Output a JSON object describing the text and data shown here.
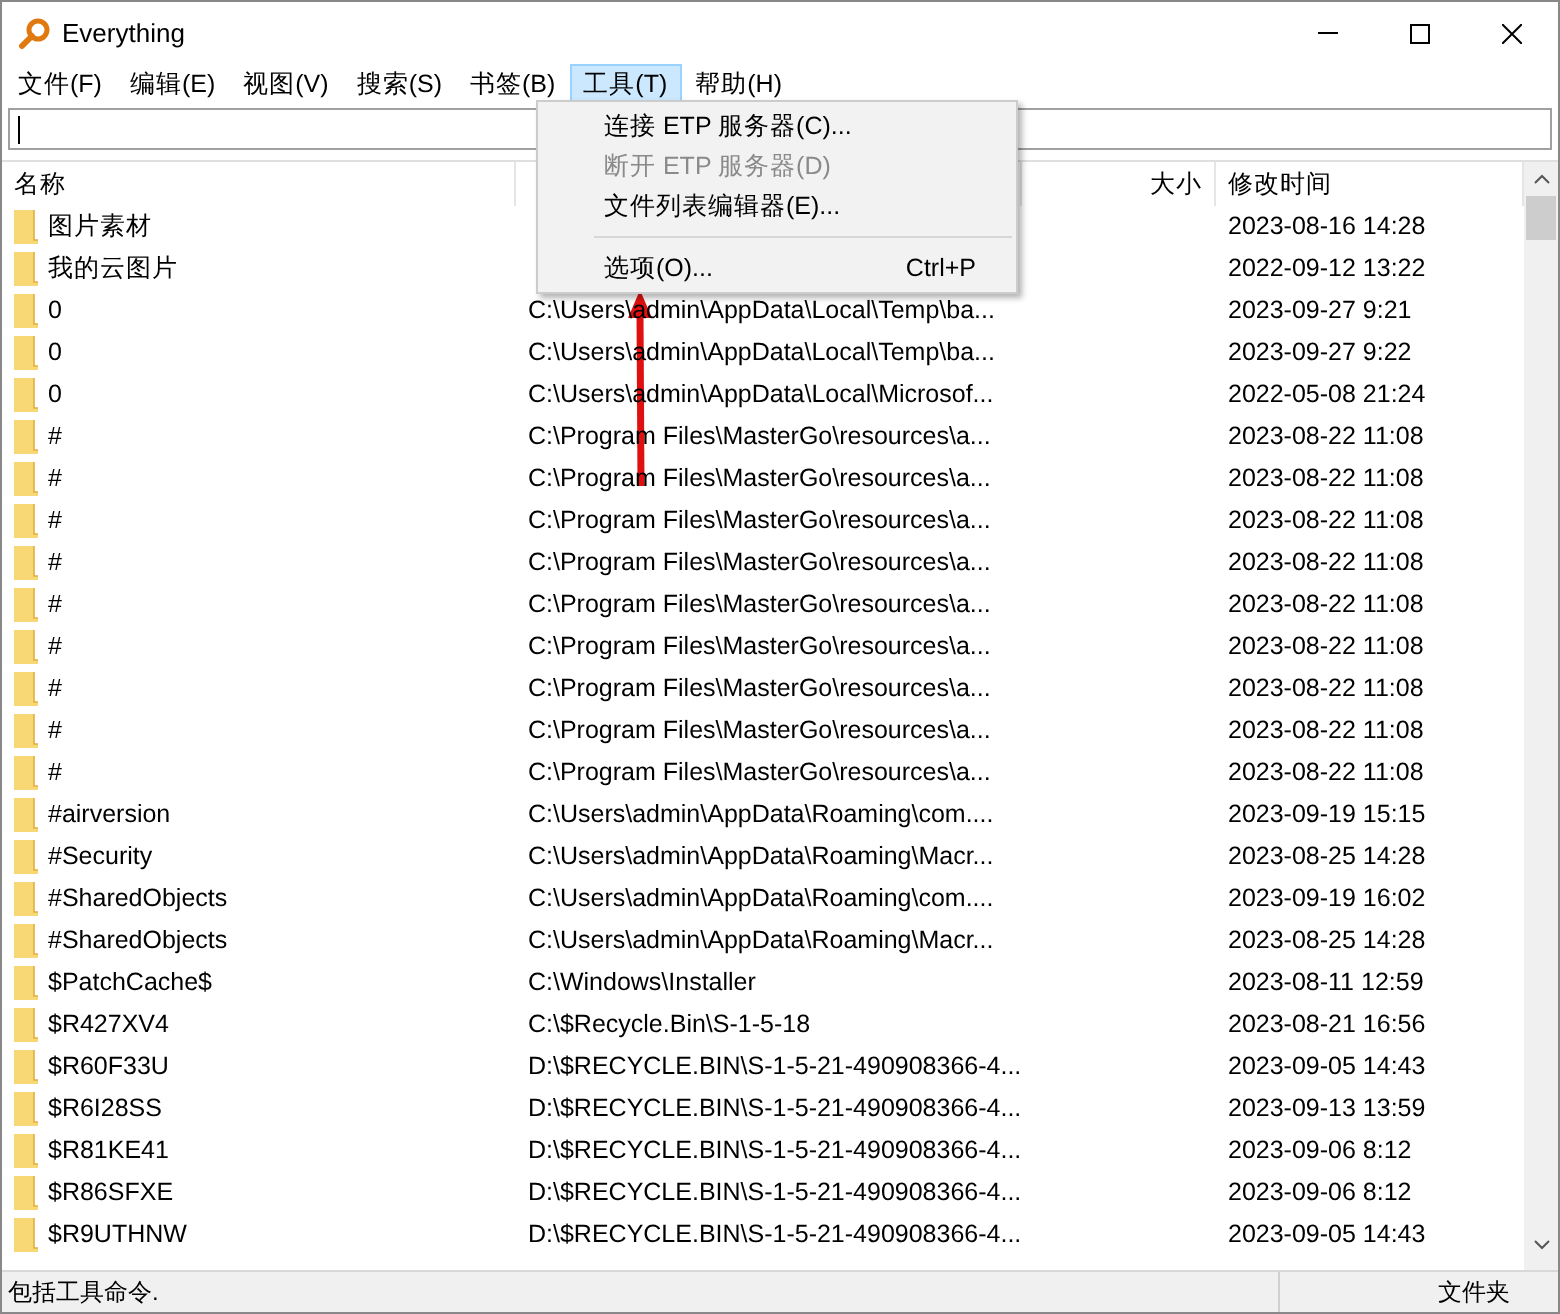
{
  "window": {
    "title": "Everything"
  },
  "menubar": [
    {
      "label": "文件(F)",
      "selected": false
    },
    {
      "label": "编辑(E)",
      "selected": false
    },
    {
      "label": "视图(V)",
      "selected": false
    },
    {
      "label": "搜索(S)",
      "selected": false
    },
    {
      "label": "书签(B)",
      "selected": false
    },
    {
      "label": "工具(T)",
      "selected": true
    },
    {
      "label": "帮助(H)",
      "selected": false
    }
  ],
  "menu": [
    {
      "kind": "item",
      "label": "连接 ETP 服务器(C)...",
      "disabled": false
    },
    {
      "kind": "item",
      "label": "断开 ETP 服务器(D)",
      "disabled": true
    },
    {
      "kind": "item",
      "label": "文件列表编辑器(E)...",
      "disabled": false
    },
    {
      "kind": "separator"
    },
    {
      "kind": "item",
      "label": "选项(O)...",
      "shortcut": "Ctrl+P",
      "disabled": false
    }
  ],
  "table": {
    "columns": [
      {
        "label": "名称"
      },
      {},
      {
        "label": "大小"
      },
      {
        "label": "修改时间"
      }
    ],
    "rows": [
      {
        "name": "图片素材",
        "modified": "2023-08-16 14:28"
      },
      {
        "name": "我的云图片",
        "modified": "2022-09-12 13:22"
      },
      {
        "name": "0",
        "path": "C:\\Users\\admin\\AppData\\Local\\Temp\\ba...",
        "modified": "2023-09-27 9:21"
      },
      {
        "name": "0",
        "path": "C:\\Users\\admin\\AppData\\Local\\Temp\\ba...",
        "modified": "2023-09-27 9:22"
      },
      {
        "name": "0",
        "path": "C:\\Users\\admin\\AppData\\Local\\Microsof...",
        "modified": "2022-05-08 21:24"
      },
      {
        "name": "#",
        "path": "C:\\Program Files\\MasterGo\\resources\\a...",
        "modified": "2023-08-22 11:08"
      },
      {
        "name": "#",
        "path": "C:\\Program Files\\MasterGo\\resources\\a...",
        "modified": "2023-08-22 11:08"
      },
      {
        "name": "#",
        "path": "C:\\Program Files\\MasterGo\\resources\\a...",
        "modified": "2023-08-22 11:08"
      },
      {
        "name": "#",
        "path": "C:\\Program Files\\MasterGo\\resources\\a...",
        "modified": "2023-08-22 11:08"
      },
      {
        "name": "#",
        "path": "C:\\Program Files\\MasterGo\\resources\\a...",
        "modified": "2023-08-22 11:08"
      },
      {
        "name": "#",
        "path": "C:\\Program Files\\MasterGo\\resources\\a...",
        "modified": "2023-08-22 11:08"
      },
      {
        "name": "#",
        "path": "C:\\Program Files\\MasterGo\\resources\\a...",
        "modified": "2023-08-22 11:08"
      },
      {
        "name": "#",
        "path": "C:\\Program Files\\MasterGo\\resources\\a...",
        "modified": "2023-08-22 11:08"
      },
      {
        "name": "#",
        "path": "C:\\Program Files\\MasterGo\\resources\\a...",
        "modified": "2023-08-22 11:08"
      },
      {
        "name": "#airversion",
        "path": "C:\\Users\\admin\\AppData\\Roaming\\com....",
        "modified": "2023-09-19 15:15"
      },
      {
        "name": "#Security",
        "path": "C:\\Users\\admin\\AppData\\Roaming\\Macr...",
        "modified": "2023-08-25 14:28"
      },
      {
        "name": "#SharedObjects",
        "path": "C:\\Users\\admin\\AppData\\Roaming\\com....",
        "modified": "2023-09-19 16:02"
      },
      {
        "name": "#SharedObjects",
        "path": "C:\\Users\\admin\\AppData\\Roaming\\Macr...",
        "modified": "2023-08-25 14:28"
      },
      {
        "name": "$PatchCache$",
        "path": "C:\\Windows\\Installer",
        "modified": "2023-08-11 12:59"
      },
      {
        "name": "$R427XV4",
        "path": "C:\\$Recycle.Bin\\S-1-5-18",
        "modified": "2023-08-21 16:56"
      },
      {
        "name": "$R60F33U",
        "path": "D:\\$RECYCLE.BIN\\S-1-5-21-490908366-4...",
        "modified": "2023-09-05 14:43"
      },
      {
        "name": "$R6I28SS",
        "path": "D:\\$RECYCLE.BIN\\S-1-5-21-490908366-4...",
        "modified": "2023-09-13 13:59"
      },
      {
        "name": "$R81KE41",
        "path": "D:\\$RECYCLE.BIN\\S-1-5-21-490908366-4...",
        "modified": "2023-09-06 8:12"
      },
      {
        "name": "$R86SFXE",
        "path": "D:\\$RECYCLE.BIN\\S-1-5-21-490908366-4...",
        "modified": "2023-09-06 8:12"
      },
      {
        "name": "$R9UTHNW",
        "path": "D:\\$RECYCLE.BIN\\S-1-5-21-490908366-4...",
        "modified": "2023-09-05 14:43"
      }
    ]
  },
  "status_bar": {
    "message": "包括工具命令.",
    "type": "文件夹"
  }
}
